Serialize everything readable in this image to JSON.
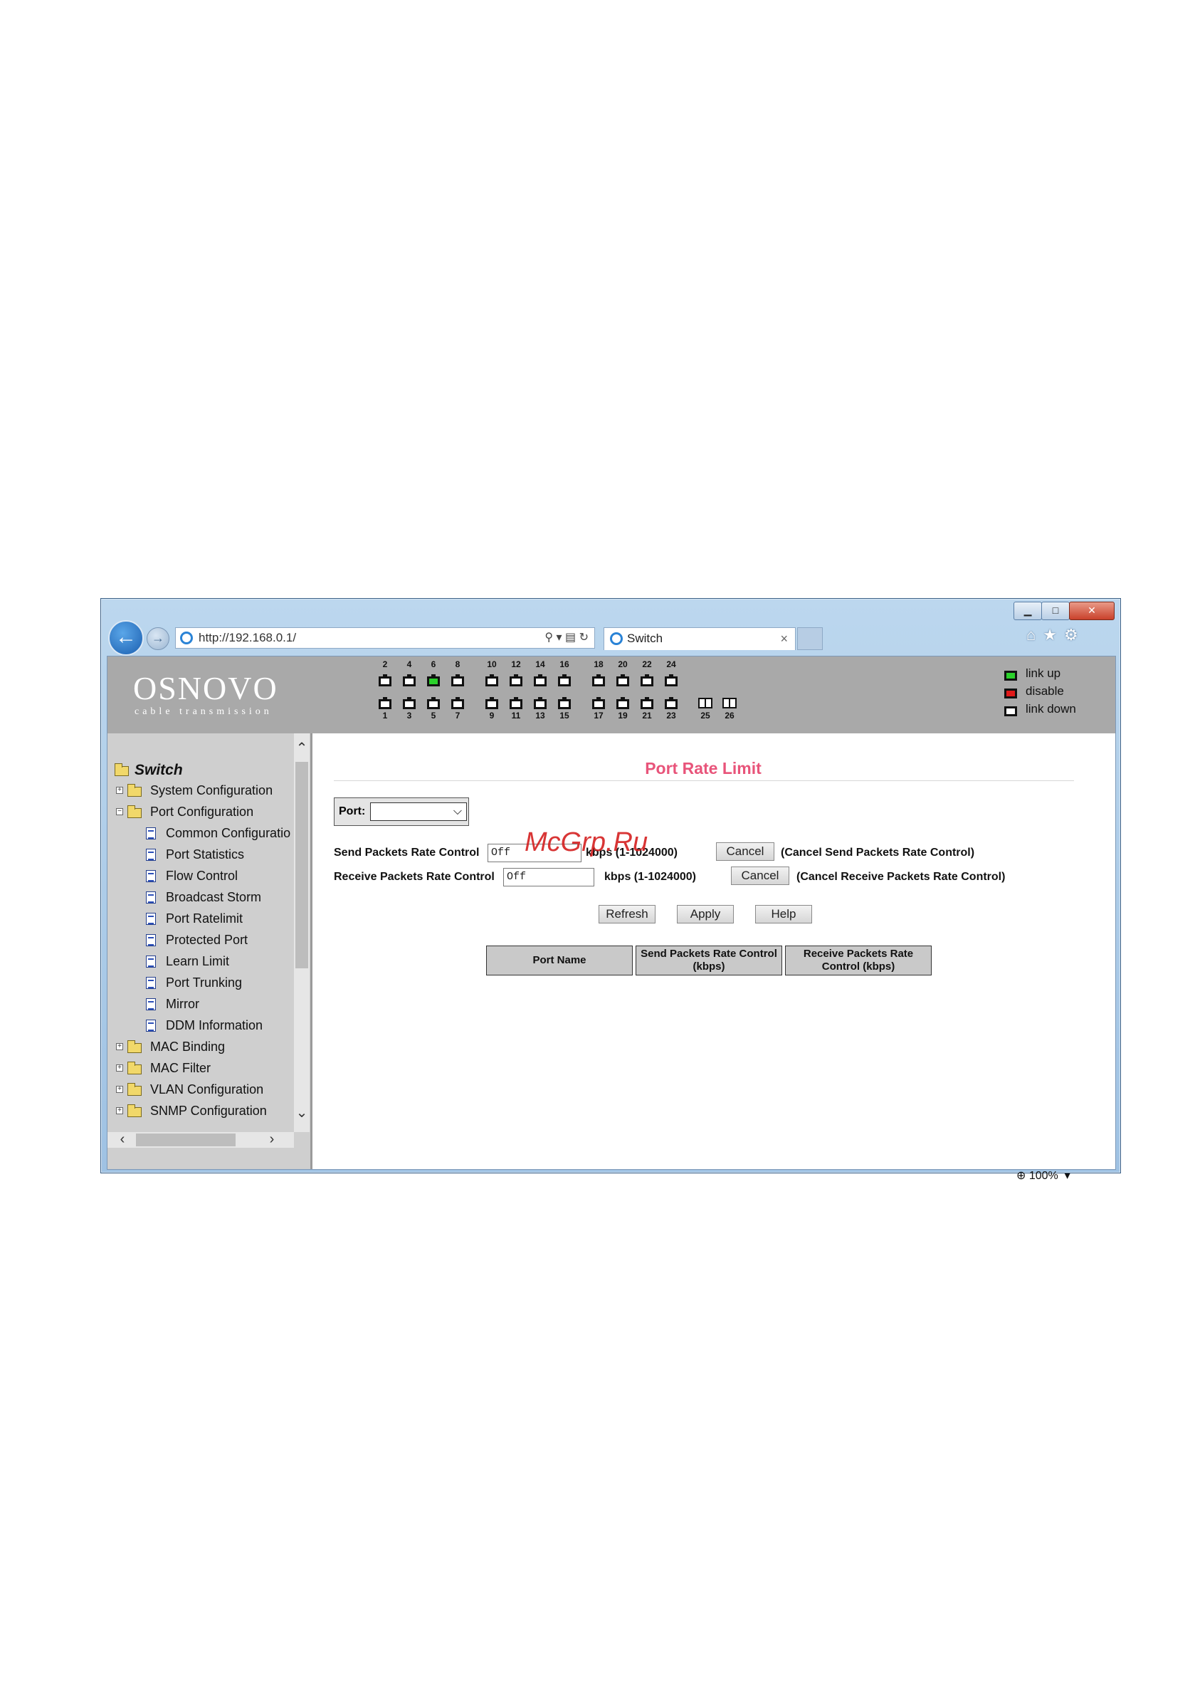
{
  "browser": {
    "url": "http://192.168.0.1/",
    "tab_title": "Switch",
    "tab_close": "×",
    "zoom": "100%"
  },
  "banner": {
    "logo": "OSNOVO",
    "logo_sub": "cable transmission",
    "ports_top": [
      "2",
      "4",
      "6",
      "8",
      "10",
      "12",
      "14",
      "16",
      "18",
      "20",
      "22",
      "24"
    ],
    "ports_bottom": [
      "1",
      "3",
      "5",
      "7",
      "9",
      "11",
      "13",
      "15",
      "17",
      "19",
      "21",
      "23",
      "25",
      "26"
    ],
    "ports_link_up": [
      "6"
    ],
    "legend": [
      {
        "label": "link up",
        "color": "#2bd12b"
      },
      {
        "label": "disable",
        "color": "#e01a1a"
      },
      {
        "label": "link down",
        "color": "#ffffff"
      }
    ]
  },
  "sidebar": {
    "root": "Switch",
    "items": [
      {
        "label": "System Configuration",
        "type": "folder",
        "expanded": false
      },
      {
        "label": "Port Configuration",
        "type": "folder",
        "expanded": true
      },
      {
        "label": "Common Configuratio",
        "type": "page"
      },
      {
        "label": "Port Statistics",
        "type": "page"
      },
      {
        "label": "Flow Control",
        "type": "page"
      },
      {
        "label": "Broadcast Storm",
        "type": "page"
      },
      {
        "label": "Port Ratelimit",
        "type": "page"
      },
      {
        "label": "Protected Port",
        "type": "page"
      },
      {
        "label": "Learn Limit",
        "type": "page"
      },
      {
        "label": "Port Trunking",
        "type": "page"
      },
      {
        "label": "Mirror",
        "type": "page"
      },
      {
        "label": "DDM Information",
        "type": "page"
      },
      {
        "label": "MAC Binding",
        "type": "folder",
        "expanded": false
      },
      {
        "label": "MAC Filter",
        "type": "folder",
        "expanded": false
      },
      {
        "label": "VLAN Configuration",
        "type": "folder",
        "expanded": false
      },
      {
        "label": "SNMP Configuration",
        "type": "folder",
        "expanded": false
      }
    ]
  },
  "main": {
    "title": "Port Rate Limit",
    "port_label": "Port:",
    "port_value": "",
    "send_label": "Send Packets Rate Control",
    "send_value": "Off",
    "send_unit": "kbps (1-1024000)",
    "send_cancel": "Cancel",
    "send_cancel_desc": "(Cancel Send Packets Rate Control)",
    "recv_label": "Receive Packets Rate Control",
    "recv_value": "Off",
    "recv_unit": "kbps (1-1024000)",
    "recv_cancel": "Cancel",
    "recv_cancel_desc": "(Cancel Receive Packets Rate Control)",
    "refresh": "Refresh",
    "apply": "Apply",
    "help": "Help",
    "table_headers": [
      "Port Name",
      "Send Packets Rate Control (kbps)",
      "Receive Packets Rate Control (kbps)"
    ]
  },
  "watermark": "McGrp.Ru"
}
